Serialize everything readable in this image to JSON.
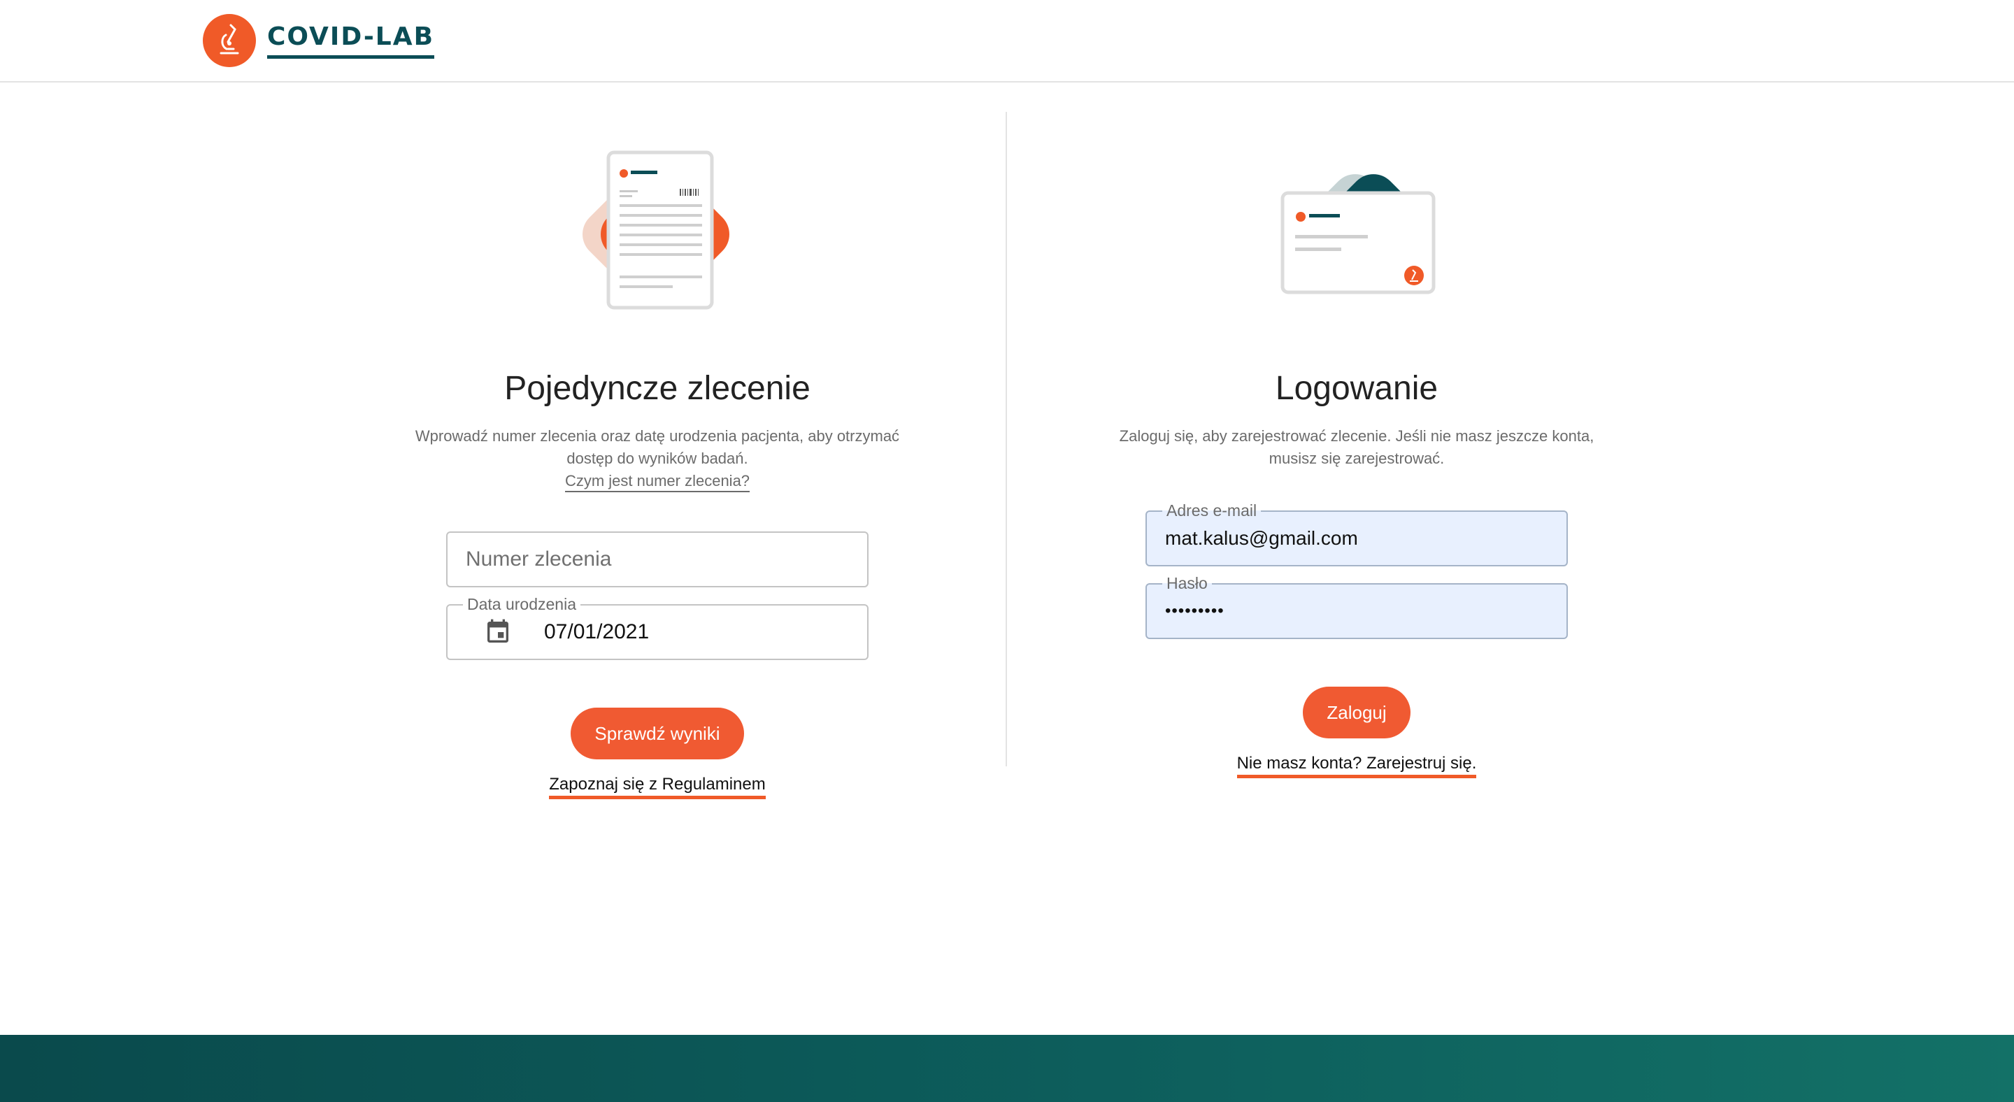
{
  "header": {
    "logo_text": "COVID-LAB"
  },
  "left_panel": {
    "title": "Pojedyncze zlecenie",
    "description": "Wprowadź numer zlecenia oraz datę urodzenia pacjenta, aby otrzymać dostęp do wyników badań.",
    "help_link": "Czym jest numer zlecenia?",
    "order_number": {
      "placeholder": "Numer zlecenia",
      "value": ""
    },
    "birth_date": {
      "label": "Data urodzenia",
      "value": "07/01/2021",
      "icon": "calendar-icon"
    },
    "submit_label": "Sprawdź wyniki",
    "terms_link": "Zapoznaj się z Regulaminem"
  },
  "right_panel": {
    "title": "Logowanie",
    "description": "Zaloguj się, aby zarejestrować zlecenie. Jeśli nie masz jeszcze konta, musisz się zarejestrować.",
    "email": {
      "label": "Adres e-mail",
      "value": "mat.kalus@gmail.com"
    },
    "password": {
      "label": "Hasło",
      "value": "•••••••••"
    },
    "login_label": "Zaloguj",
    "register_link": "Nie masz konta? Zarejestruj się."
  },
  "colors": {
    "accent": "#f05a28",
    "brand_dark": "#0b4d56",
    "autofill": "#e8f0fe",
    "footer": "#0d5e5c"
  }
}
